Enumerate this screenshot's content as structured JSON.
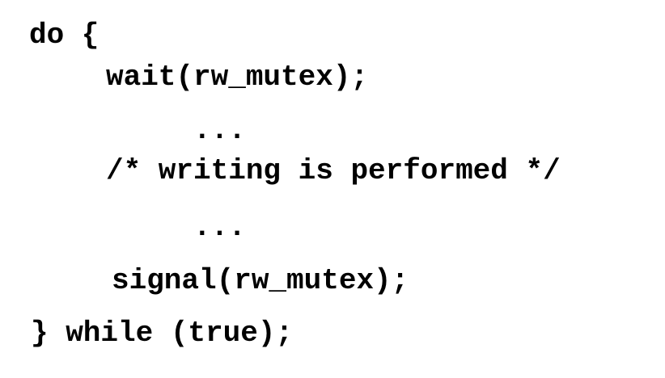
{
  "code": {
    "lines": [
      "do {",
      "wait(rw_mutex);",
      "...",
      "/* writing is performed */",
      "...",
      "signal(rw_mutex);",
      "} while (true);"
    ]
  }
}
